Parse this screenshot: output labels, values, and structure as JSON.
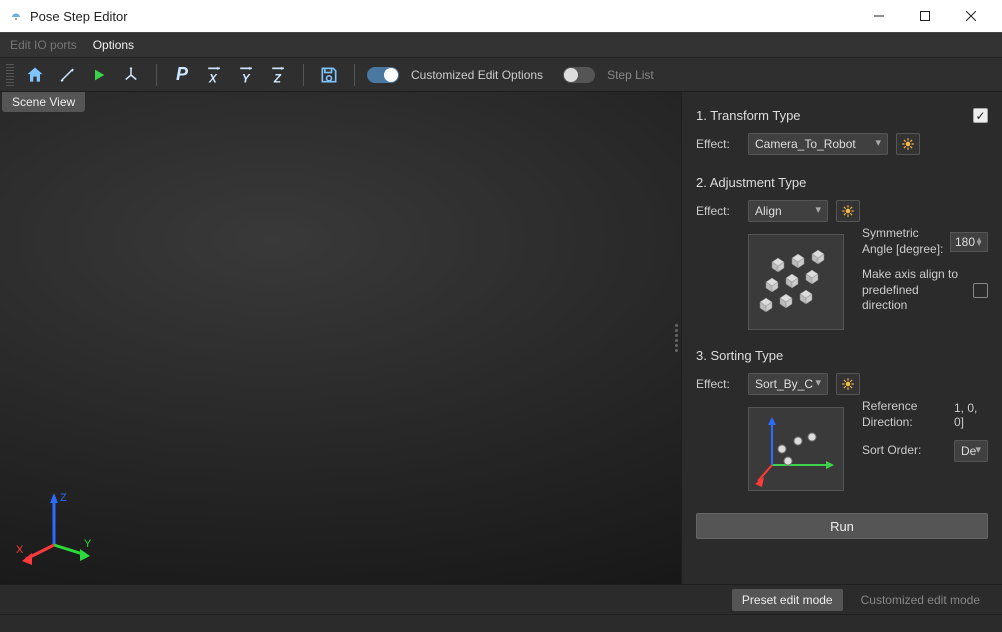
{
  "window": {
    "title": "Pose Step Editor"
  },
  "menubar": {
    "edit_io_ports": "Edit IO ports",
    "options": "Options"
  },
  "toolbar": {
    "customized_label": "Customized Edit Options",
    "steplist_label": "Step List"
  },
  "scene": {
    "tab_label": "Scene View"
  },
  "panel": {
    "section1": {
      "title": "1. Transform Type",
      "enabled": true,
      "effect_label": "Effect:",
      "effect_value": "Camera_To_Robot"
    },
    "section2": {
      "title": "2. Adjustment Type",
      "effect_label": "Effect:",
      "effect_value": "Align",
      "symmetric_angle_label": "Symmetric Angle [degree]:",
      "symmetric_angle_value": "180",
      "make_axis_label": "Make axis align to predefined direction",
      "make_axis_checked": false
    },
    "section3": {
      "title": "3. Sorting Type",
      "effect_label": "Effect:",
      "effect_value": "Sort_By_C",
      "reference_direction_label": "Reference Direction:",
      "reference_direction_value": "1, 0, 0]",
      "sort_order_label": "Sort Order:",
      "sort_order_value": "De"
    },
    "run_label": "Run"
  },
  "modebar": {
    "preset_label": "Preset edit mode",
    "customized_label": "Customized edit mode"
  }
}
